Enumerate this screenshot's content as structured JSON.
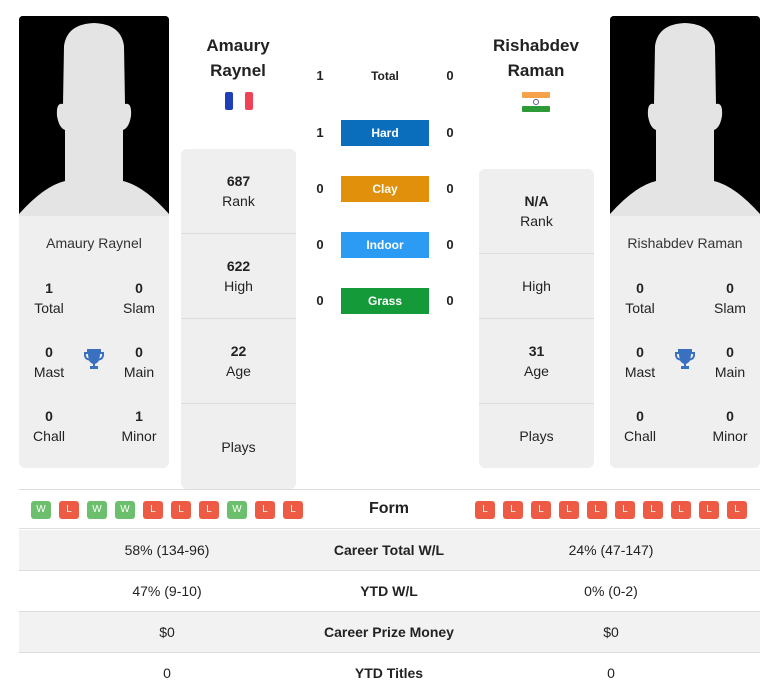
{
  "player1": {
    "name_line1": "Amaury",
    "name_line2": "Raynel",
    "full_name": "Amaury Raynel",
    "flag": "france-flag",
    "titles": {
      "total": "1",
      "total_label": "Total",
      "slam": "0",
      "slam_label": "Slam",
      "mast": "0",
      "mast_label": "Mast",
      "main": "0",
      "main_label": "Main",
      "chall": "0",
      "chall_label": "Chall",
      "minor": "1",
      "minor_label": "Minor"
    },
    "rank": "687",
    "rank_label": "Rank",
    "high": "622",
    "high_label": "High",
    "age": "22",
    "age_label": "Age",
    "plays_label": "Plays",
    "form": [
      "W",
      "L",
      "W",
      "W",
      "L",
      "L",
      "L",
      "W",
      "L",
      "L"
    ]
  },
  "player2": {
    "name_line1": "Rishabdev",
    "name_line2": "Raman",
    "full_name": "Rishabdev Raman",
    "flag": "india-flag",
    "titles": {
      "total": "0",
      "total_label": "Total",
      "slam": "0",
      "slam_label": "Slam",
      "mast": "0",
      "mast_label": "Mast",
      "main": "0",
      "main_label": "Main",
      "chall": "0",
      "chall_label": "Chall",
      "minor": "0",
      "minor_label": "Minor"
    },
    "rank": "N/A",
    "rank_label": "Rank",
    "high_label": "High",
    "age": "31",
    "age_label": "Age",
    "plays_label": "Plays",
    "form": [
      "L",
      "L",
      "L",
      "L",
      "L",
      "L",
      "L",
      "L",
      "L",
      "L"
    ]
  },
  "h2h": [
    {
      "label": "Total",
      "p1": "1",
      "p2": "0",
      "color": null
    },
    {
      "label": "Hard",
      "p1": "1",
      "p2": "0",
      "color": "#0a6ebd"
    },
    {
      "label": "Clay",
      "p1": "0",
      "p2": "0",
      "color": "#e0900a"
    },
    {
      "label": "Indoor",
      "p1": "0",
      "p2": "0",
      "color": "#2b9bf4"
    },
    {
      "label": "Grass",
      "p1": "0",
      "p2": "0",
      "color": "#159a3a"
    }
  ],
  "form_label": "Form",
  "stats": [
    {
      "label": "Career Total W/L",
      "p1": "58% (134-96)",
      "p2": "24% (47-147)"
    },
    {
      "label": "YTD W/L",
      "p1": "47% (9-10)",
      "p2": "0% (0-2)"
    },
    {
      "label": "Career Prize Money",
      "p1": "$0",
      "p2": "$0"
    },
    {
      "label": "YTD Titles",
      "p1": "0",
      "p2": "0"
    }
  ]
}
